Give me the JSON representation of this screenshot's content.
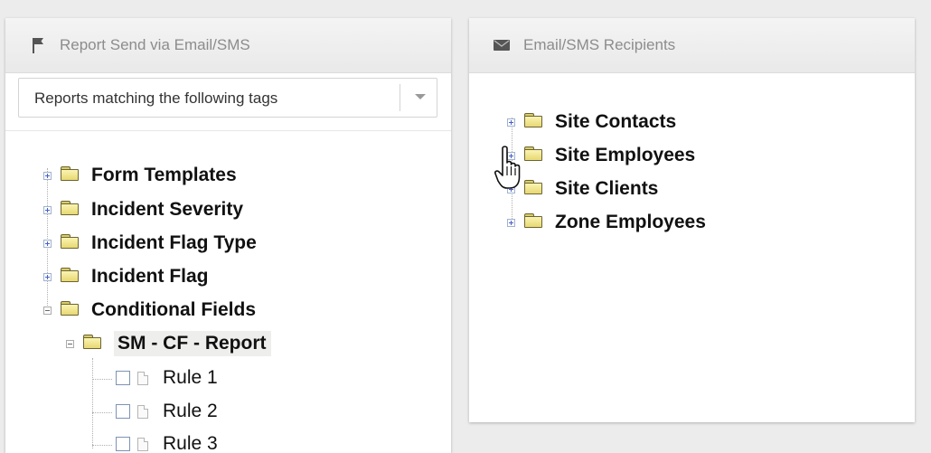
{
  "left_panel": {
    "title": "Report Send via Email/SMS",
    "header_icon": "flag-icon",
    "filter_select": {
      "value": "Reports matching the following tags"
    },
    "tree": {
      "nodes": [
        {
          "label": "Form Templates",
          "state": "collapsed"
        },
        {
          "label": "Incident Severity",
          "state": "collapsed"
        },
        {
          "label": "Incident Flag Type",
          "state": "collapsed"
        },
        {
          "label": "Incident Flag",
          "state": "collapsed"
        },
        {
          "label": "Conditional Fields",
          "state": "expanded"
        }
      ],
      "child": {
        "label": "SM - CF - Report",
        "state": "expanded"
      },
      "rules": [
        {
          "label": "Rule 1",
          "checked": false
        },
        {
          "label": "Rule 2",
          "checked": false
        },
        {
          "label": "Rule 3",
          "checked": false
        }
      ]
    }
  },
  "right_panel": {
    "title": "Email/SMS Recipients",
    "header_icon": "envelope-icon",
    "tree": {
      "nodes": [
        {
          "label": "Site Contacts",
          "state": "collapsed"
        },
        {
          "label": "Site Employees",
          "state": "collapsed"
        },
        {
          "label": "Site Clients",
          "state": "collapsed"
        },
        {
          "label": "Zone Employees",
          "state": "collapsed"
        }
      ]
    }
  },
  "cursor": {
    "type": "hand-pointer-icon"
  }
}
